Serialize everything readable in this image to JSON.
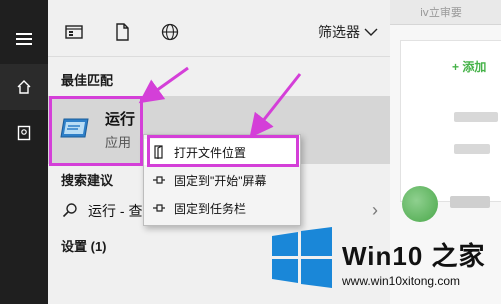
{
  "background_app": {
    "tab_text": "ⅳ立审要",
    "add_label": "+ 添加"
  },
  "toolbar": {
    "filter_label": "筛选器"
  },
  "sections": {
    "best_match": "最佳匹配",
    "suggestions": "搜索建议",
    "settings": "设置 (1)"
  },
  "best_match_item": {
    "title": "运行",
    "subtitle": "应用"
  },
  "suggestion_item": {
    "text": "运行 - 查"
  },
  "context_menu": {
    "items": [
      {
        "label": "打开文件位置",
        "icon": "folder-open-icon"
      },
      {
        "label": "固定到\"开始\"屏幕",
        "icon": "pin-icon"
      },
      {
        "label": "固定到任务栏",
        "icon": "pin-icon"
      }
    ]
  },
  "watermark": {
    "title": "Win10 之家",
    "url": "www.win10xitong.com"
  },
  "colors": {
    "highlight": "#d43fd8",
    "rail": "#1f1f1f",
    "panel": "#f0f0f0",
    "win_blue": "#1a87d8"
  }
}
